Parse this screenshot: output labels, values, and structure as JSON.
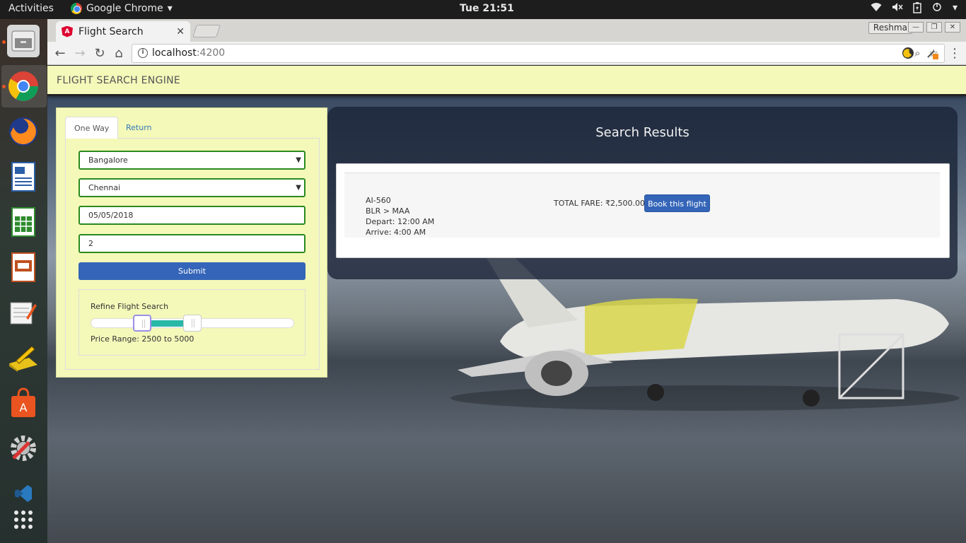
{
  "os": {
    "activities": "Activities",
    "app_name": "Google Chrome",
    "clock": "Tue 21:51"
  },
  "browser": {
    "tab_title": "Flight Search",
    "profile_name": "Reshma",
    "url_host": "localhost",
    "url_port": ":4200"
  },
  "page": {
    "brand": "FLIGHT SEARCH ENGINE",
    "search": {
      "tabs": [
        "One Way",
        "Return"
      ],
      "origin": "Bangalore",
      "destination": "Chennai",
      "date": "05/05/2018",
      "passengers": "2",
      "submit_label": "Submit",
      "refine_title": "Refine Flight Search",
      "price_range_label": "Price Range: 2500 to 5000",
      "slider_min_fraction": 0.25,
      "slider_max_fraction": 0.5
    },
    "results": {
      "title": "Search Results",
      "flights": [
        {
          "code": "AI-560",
          "route": "BLR > MAA",
          "depart": "Depart: 12:00 AM",
          "arrive": "Arrive: 4:00 AM",
          "fare": "TOTAL FARE: ₹2,500.00",
          "book_label": "Book this flight"
        }
      ]
    }
  },
  "colors": {
    "navbar_bg": "#f4f8b9",
    "primary_button": "#3465b8",
    "field_border": "#2a8a1f",
    "slider_fill": "#27b8a8"
  }
}
